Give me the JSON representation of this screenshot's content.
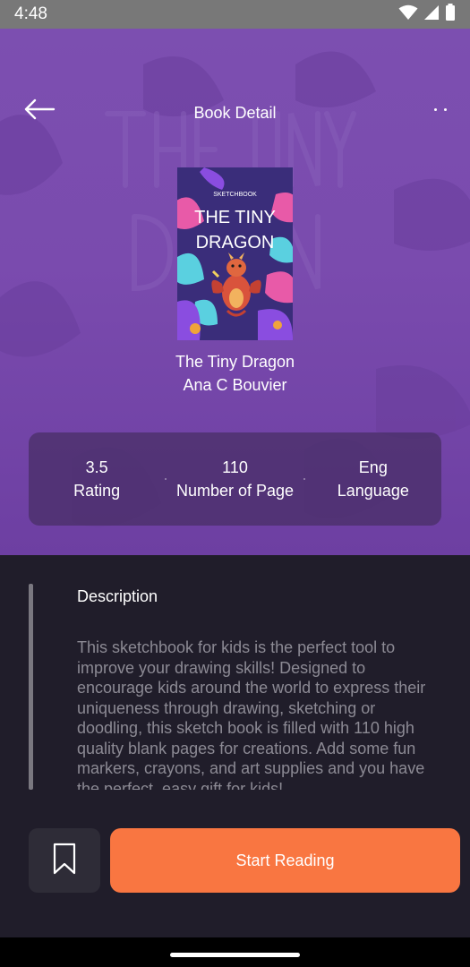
{
  "status": {
    "time": "4:48"
  },
  "header": {
    "title": "Book Detail"
  },
  "book": {
    "title": "The Tiny Dragon",
    "author": "Ana C Bouvier",
    "cover_title_line1": "THE TINY",
    "cover_title_line2": "DRAGON",
    "cover_kicker": "SKETCHBOOK"
  },
  "stats": [
    {
      "value": "3.5",
      "label": "Rating"
    },
    {
      "value": "110",
      "label": "Number of Page"
    },
    {
      "value": "Eng",
      "label": "Language"
    }
  ],
  "description": {
    "heading": "Description",
    "body": "This sketchbook for kids is the perfect tool to improve your drawing skills! Designed to encourage kids around the world to express their uniqueness through drawing, sketching or doodling, this sketch book is filled with 110 high quality blank pages for creations. Add some fun markers, crayons, and art supplies and you have the perfect, easy gift for kids!"
  },
  "actions": {
    "start_label": "Start Reading"
  },
  "colors": {
    "accent": "#f97641",
    "hero": "#7a4bae",
    "background": "#201d2a"
  }
}
